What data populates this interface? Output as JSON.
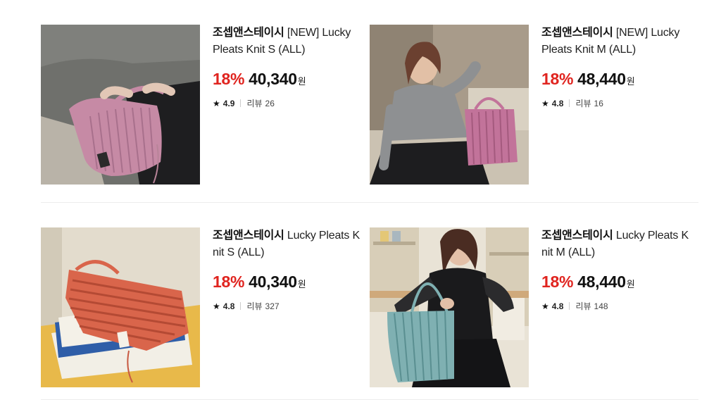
{
  "products": [
    {
      "brand": "조셉앤스테이시",
      "name": "[NEW] Lucky Pleats Knit S (ALL)",
      "discount": "18%",
      "price": "40,340",
      "currency": "원",
      "rating": "4.9",
      "review_label": "리뷰",
      "review_count": "26",
      "image": "pink-knit-bag-photo"
    },
    {
      "brand": "조셉앤스테이시",
      "name": "[NEW] Lucky Pleats Knit M (ALL)",
      "discount": "18%",
      "price": "48,440",
      "currency": "원",
      "rating": "4.8",
      "review_label": "리뷰",
      "review_count": "16",
      "image": "woman-with-pink-bag-photo"
    },
    {
      "brand": "조셉앤스테이시",
      "name": "Lucky Pleats Knit S (ALL)",
      "discount": "18%",
      "price": "40,340",
      "currency": "원",
      "rating": "4.8",
      "review_label": "리뷰",
      "review_count": "327",
      "image": "coral-bag-on-books-photo"
    },
    {
      "brand": "조셉앤스테이시",
      "name": "Lucky Pleats Knit M (ALL)",
      "discount": "18%",
      "price": "48,440",
      "currency": "원",
      "rating": "4.8",
      "review_label": "리뷰",
      "review_count": "148",
      "image": "woman-with-mint-bag-photo"
    }
  ],
  "colors": {
    "discount": "#e0241f",
    "text": "#111111"
  }
}
